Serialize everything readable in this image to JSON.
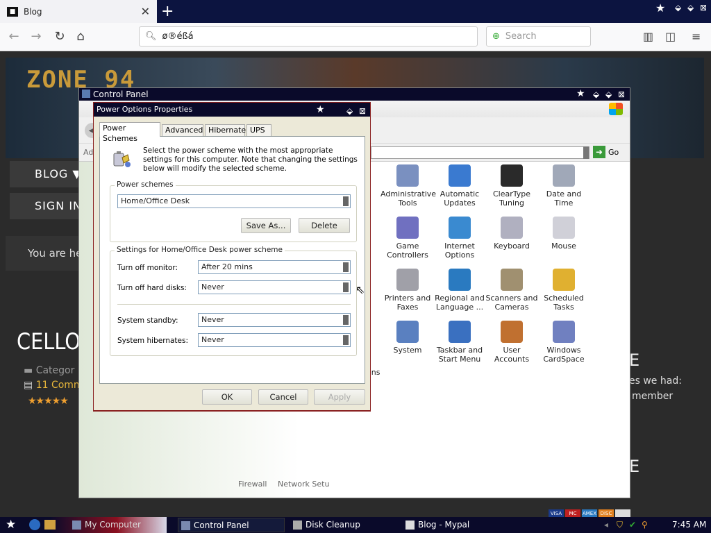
{
  "browser": {
    "tab_title": "Blog",
    "tab_favicon": "■",
    "url_text": "ø®éßá",
    "search_placeholder": "Search",
    "icons": {
      "back": "back-icon",
      "forward": "forward-icon",
      "reload": "reload-icon",
      "home": "home-icon",
      "library": "library-icon",
      "sidebar": "sidebar-icon",
      "menu": "menu-icon"
    }
  },
  "site": {
    "logo": "ZONE 94",
    "menu_blog": "BLOG ▼",
    "menu_signin": "SIGN IN",
    "breadcrumb": "You are he",
    "post_title": "CELLO",
    "category": "Categor",
    "comments": "11 Comm",
    "stars": "★★★★★",
    "right_heading_1": "E",
    "right_text_1": "es we had:",
    "right_text_2": "member",
    "right_heading_2": "E",
    "cards": [
      "VISA",
      "MC",
      "AMEX",
      "DISC",
      ""
    ]
  },
  "control_panel": {
    "title": "Control Panel",
    "address_label": "Ado",
    "go_label": "Go",
    "items": [
      {
        "label": "Administrative Tools",
        "color": "#7a90c0"
      },
      {
        "label": "Automatic Updates",
        "color": "#3a7ad0"
      },
      {
        "label": "ClearType Tuning",
        "color": "#2a2a2a"
      },
      {
        "label": "Date and Time",
        "color": "#a0a8b8"
      },
      {
        "label": "Game Controllers",
        "color": "#7070c0"
      },
      {
        "label": "Internet Options",
        "color": "#3a8ad0"
      },
      {
        "label": "Keyboard",
        "color": "#b0b0c0"
      },
      {
        "label": "Mouse",
        "color": "#d0d0d8"
      },
      {
        "label": "Printers and Faxes",
        "color": "#a0a0a8"
      },
      {
        "label": "Regional and Language ...",
        "color": "#2a7ac0"
      },
      {
        "label": "Scanners and Cameras",
        "color": "#a09070"
      },
      {
        "label": "Scheduled Tasks",
        "color": "#e0b030"
      },
      {
        "label": "System",
        "color": "#5a80c0"
      },
      {
        "label": "Taskbar and Start Menu",
        "color": "#3a70c0"
      },
      {
        "label": "User Accounts",
        "color": "#c07030"
      },
      {
        "label": "Windows CardSpace",
        "color": "#7080c0"
      }
    ],
    "partial_left": "ons",
    "partial_bottom_1": "Firewall",
    "partial_bottom_2": "Network Setu"
  },
  "power_options": {
    "title": "Power Options Properties",
    "tabs": [
      "Power Schemes",
      "Advanced",
      "Hibernate",
      "UPS"
    ],
    "description": "Select the power scheme with the most appropriate settings for this computer. Note that changing the settings below will modify the selected scheme.",
    "schemes_group": "Power schemes",
    "current_scheme": "Home/Office Desk",
    "save_as": "Save As...",
    "delete": "Delete",
    "settings_group": "Settings for Home/Office Desk power scheme",
    "fields": [
      {
        "label": "Turn off monitor:",
        "value": "After 20 mins"
      },
      {
        "label": "Turn off hard disks:",
        "value": "Never"
      },
      {
        "label": "System standby:",
        "value": "Never"
      },
      {
        "label": "System hibernates:",
        "value": "Never"
      }
    ],
    "ok": "OK",
    "cancel": "Cancel",
    "apply": "Apply"
  },
  "taskbar": {
    "items": [
      {
        "label": "My Computer"
      },
      {
        "label": "Control Panel"
      },
      {
        "label": "Disk Cleanup"
      },
      {
        "label": "Blog - Mypal"
      }
    ],
    "clock": "7:45 AM"
  }
}
